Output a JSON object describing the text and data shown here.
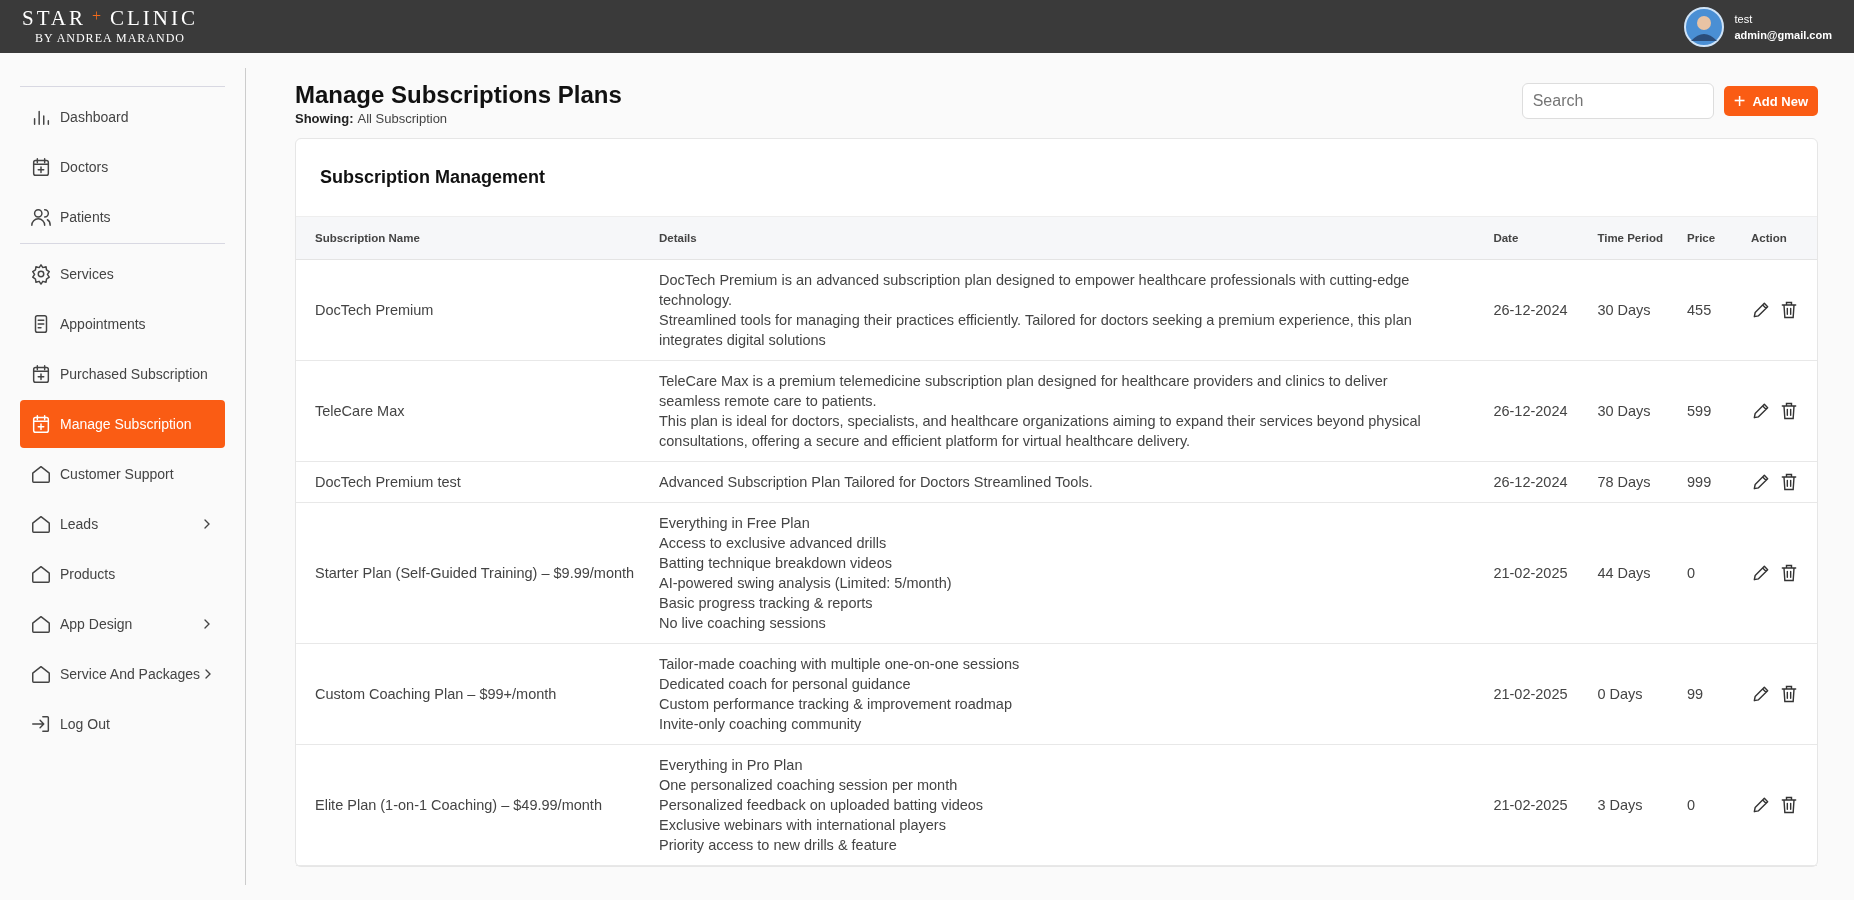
{
  "header": {
    "logo": {
      "word_1": "STAR",
      "separator": "+",
      "word_2": "CLINIC",
      "tagline": "BY ANDREA MARANDO"
    },
    "user": {
      "name": "test",
      "email": "admin@gmail.com"
    }
  },
  "sidebar": {
    "groups": [
      {
        "items": [
          {
            "label": "Dashboard",
            "kind": "chart",
            "selected": false,
            "expandable": false
          },
          {
            "label": "Doctors",
            "kind": "calendar",
            "selected": false,
            "expandable": false
          },
          {
            "label": "Patients",
            "kind": "users",
            "selected": false,
            "expandable": false
          }
        ]
      },
      {
        "items": [
          {
            "label": "Services",
            "kind": "gear",
            "selected": false,
            "expandable": false
          },
          {
            "label": "Appointments",
            "kind": "document",
            "selected": false,
            "expandable": false
          },
          {
            "label": "Purchased Subscription",
            "kind": "calendar",
            "selected": false,
            "expandable": false
          },
          {
            "label": "Manage Subscription",
            "kind": "calendar",
            "selected": true,
            "expandable": false
          },
          {
            "label": "Customer Support",
            "kind": "house",
            "selected": false,
            "expandable": false
          },
          {
            "label": "Leads",
            "kind": "house",
            "selected": false,
            "expandable": true
          },
          {
            "label": "Products",
            "kind": "house",
            "selected": false,
            "expandable": false
          },
          {
            "label": "App Design",
            "kind": "house",
            "selected": false,
            "expandable": true
          },
          {
            "label": "Service And Packages",
            "kind": "house",
            "selected": false,
            "expandable": true
          },
          {
            "label": "Log Out",
            "kind": "logout",
            "selected": false,
            "expandable": false
          }
        ]
      }
    ]
  },
  "page": {
    "title": "Manage Subscriptions Plans",
    "showing_label": "Showing:",
    "showing_value": "All Subscription",
    "search": {
      "placeholder": "Search"
    },
    "add_button": {
      "icon": "+",
      "label": "Add New"
    }
  },
  "card": {
    "title": "Subscription Management",
    "table": {
      "columns": [
        "Subscription Name",
        "Details",
        "Date",
        "Time Period",
        "Price",
        "Action"
      ],
      "rows": [
        {
          "name": "DocTech Premium",
          "details": [
            "DocTech Premium is an advanced subscription plan designed to empower healthcare professionals with cutting-edge technology.",
            "Streamlined tools for managing their practices efficiently. Tailored for doctors seeking a premium experience, this plan integrates digital solutions"
          ],
          "date": "26-12-2024",
          "period": "30 Days",
          "price": "455"
        },
        {
          "name": "TeleCare Max",
          "details": [
            "TeleCare Max is a premium telemedicine subscription plan designed for healthcare providers and clinics to deliver seamless remote care to patients.",
            "This plan is ideal for doctors, specialists, and healthcare organizations aiming to expand their services beyond physical consultations, offering a secure and efficient platform for virtual healthcare delivery."
          ],
          "date": "26-12-2024",
          "period": "30 Days",
          "price": "599"
        },
        {
          "name": "DocTech Premium test",
          "details": [
            "Advanced Subscription Plan Tailored for Doctors Streamlined Tools."
          ],
          "date": "26-12-2024",
          "period": "78 Days",
          "price": "999"
        },
        {
          "name": "Starter Plan (Self-Guided Training) – $9.99/month",
          "details": [
            "Everything in Free Plan",
            "Access to exclusive advanced drills",
            "Batting technique breakdown videos",
            "AI-powered swing analysis (Limited: 5/month)",
            "Basic progress tracking & reports",
            "No live coaching sessions"
          ],
          "date": "21-02-2025",
          "period": "44 Days",
          "price": "0"
        },
        {
          "name": "Custom Coaching Plan – $99+/month",
          "details": [
            "Tailor-made coaching with multiple one-on-one sessions",
            "Dedicated coach for personal guidance",
            "Custom performance tracking & improvement roadmap",
            "Invite-only coaching community"
          ],
          "date": "21-02-2025",
          "period": "0 Days",
          "price": "99"
        },
        {
          "name": "Elite Plan (1-on-1 Coaching) – $49.99/month",
          "details": [
            "Everything in Pro Plan",
            "One personalized coaching session per month",
            "Personalized feedback on uploaded batting videos",
            "Exclusive webinars with international players",
            "Priority access to new drills & feature"
          ],
          "date": "21-02-2025",
          "period": "3 Days",
          "price": "0"
        }
      ]
    }
  }
}
